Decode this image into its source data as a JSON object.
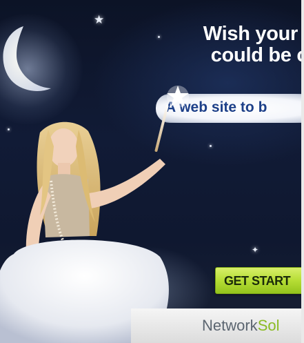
{
  "ad": {
    "headline_line1": "Wish your b",
    "headline_line2": "could be c",
    "subheadline": "A web site to b",
    "cta_label": "GET START",
    "logo_part1": "Network",
    "logo_part2": "Sol"
  },
  "colors": {
    "sky": "#0f1830",
    "headline": "#ffffff",
    "subheadline": "#1c3f88",
    "cta": "#b6dd35",
    "logo_network": "#5b6570",
    "logo_sol": "#8bbb24"
  }
}
